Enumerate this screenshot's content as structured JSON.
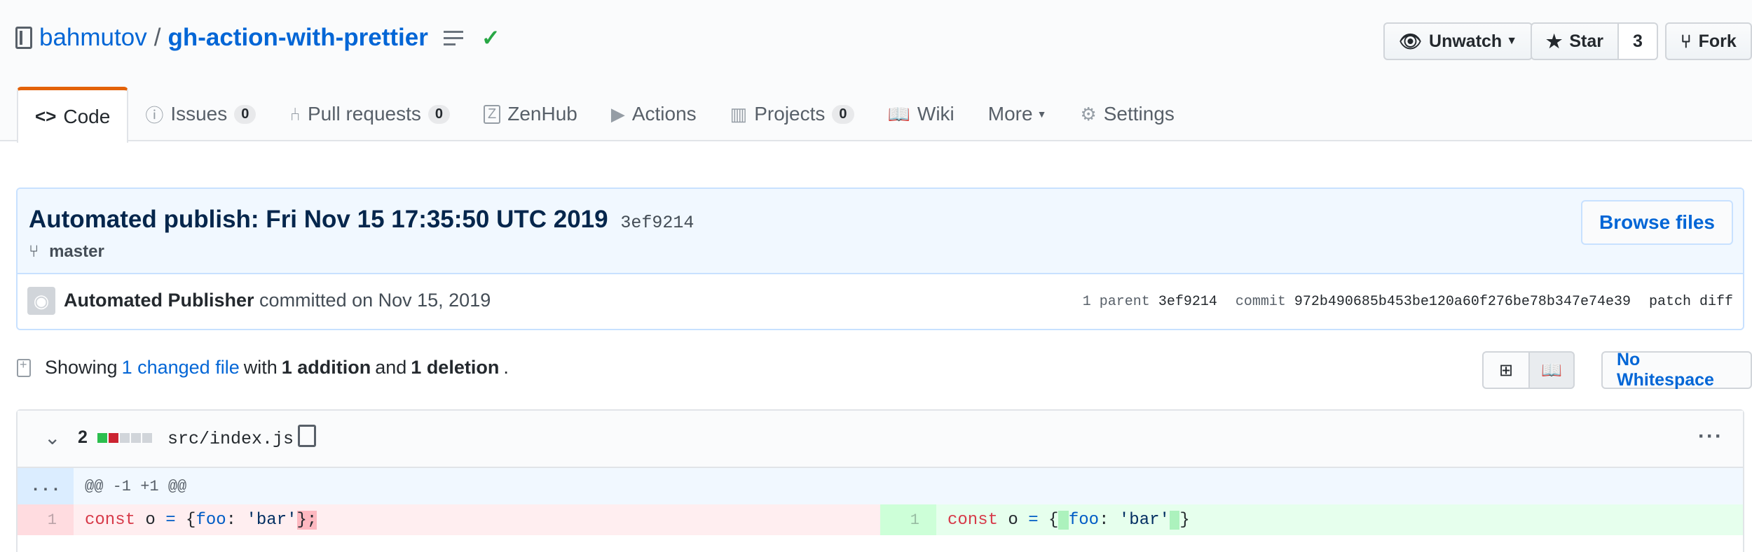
{
  "repo": {
    "owner": "bahmutov",
    "separator": "/",
    "name": "gh-action-with-prettier",
    "check_icon": "check-icon"
  },
  "actions": {
    "watch_label": "Unwatch",
    "star_label": "Star",
    "star_count": "3",
    "fork_label": "Fork"
  },
  "tabs": [
    {
      "label": "Code",
      "icon": "code-icon",
      "count": ""
    },
    {
      "label": "Issues",
      "icon": "issue-icon",
      "count": "0"
    },
    {
      "label": "Pull requests",
      "icon": "pull-request-icon",
      "count": "0"
    },
    {
      "label": "ZenHub",
      "icon": "zenhub-icon",
      "count": ""
    },
    {
      "label": "Actions",
      "icon": "play-icon",
      "count": ""
    },
    {
      "label": "Projects",
      "icon": "project-icon",
      "count": "0"
    },
    {
      "label": "Wiki",
      "icon": "book-icon",
      "count": ""
    },
    {
      "label": "More",
      "icon": "caret-down-icon",
      "count": ""
    },
    {
      "label": "Settings",
      "icon": "gear-icon",
      "count": ""
    }
  ],
  "commit": {
    "title": "Automated publish: Fri Nov 15 17:35:50 UTC 2019",
    "short_sha": "3ef9214",
    "branch": "master",
    "browse_label": "Browse files",
    "author": "Automated Publisher",
    "committed_text": "committed on Nov 15, 2019",
    "parent_label": "1 parent",
    "parent_sha": "3ef9214",
    "commit_label": "commit",
    "commit_sha": "972b490685b453be120a60f276be78b347e74e39",
    "patch_label": "patch",
    "diff_label": "diff"
  },
  "toc": {
    "showing": "Showing",
    "changed": "1 changed file",
    "with": "with",
    "additions": "1 addition",
    "and": "and",
    "deletions": "1 deletion",
    "period": ".",
    "no_whitespace": "No Whitespace"
  },
  "file": {
    "changes": "2",
    "path": "src/index.js",
    "hunk": "@@ -1 +1 @@",
    "expander": "...",
    "left_line_no": "1",
    "right_line_no": "1"
  },
  "colors": {
    "accent": "#0366d6",
    "selected_tab": "#e36209",
    "success": "#28a745",
    "addition": "#2cbe4e",
    "deletion": "#cb2431"
  }
}
